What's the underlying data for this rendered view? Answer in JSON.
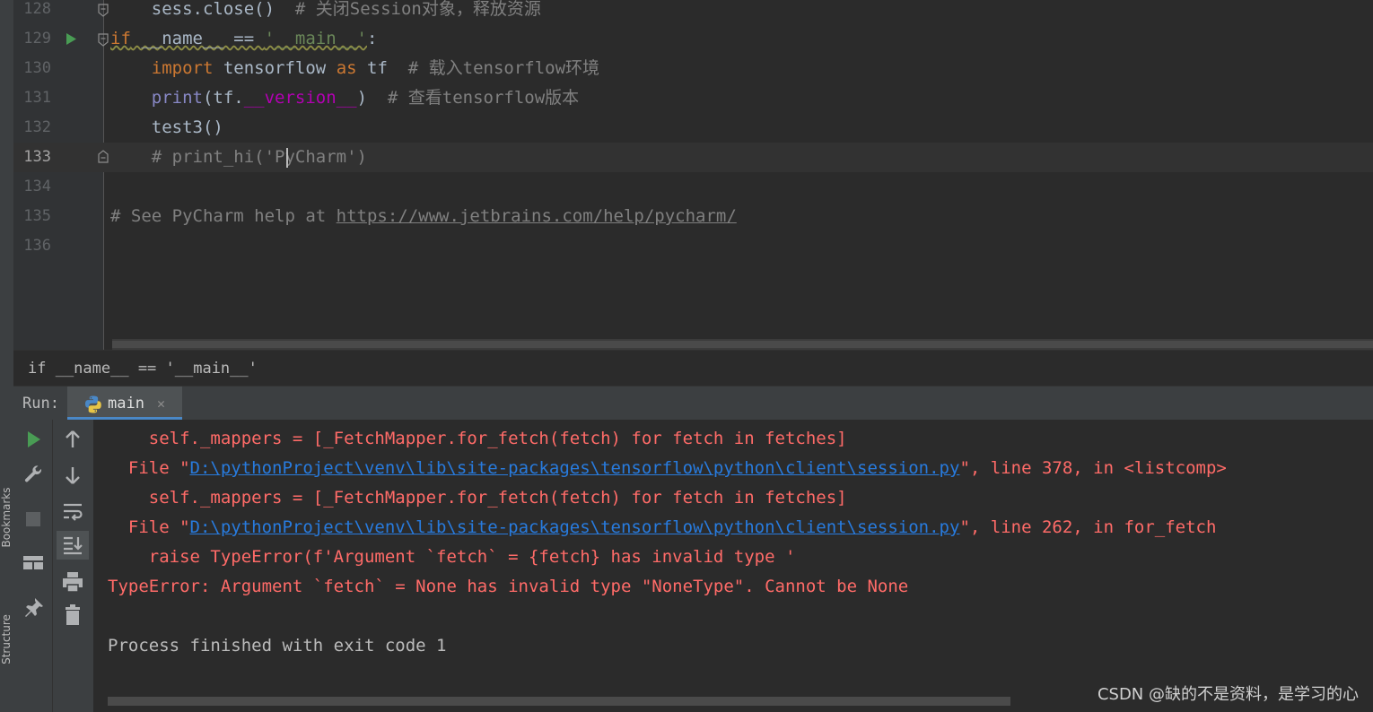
{
  "side_tabs": {
    "bookmarks": "Bookmarks",
    "structure": "Structure"
  },
  "editor": {
    "lines": [
      {
        "num": "128",
        "segments": [
          {
            "t": "    sess.close()  ",
            "c": ""
          },
          {
            "t": "# 关闭Session对象，释放资源",
            "c": "cm"
          }
        ]
      },
      {
        "num": "129",
        "segments": [
          {
            "t": "if",
            "c": "kw wavy"
          },
          {
            "t": " __name__ == ",
            "c": "wavy"
          },
          {
            "t": "'__main__'",
            "c": "str wavy"
          },
          {
            "t": ":",
            "c": ""
          }
        ]
      },
      {
        "num": "130",
        "segments": [
          {
            "t": "    ",
            "c": ""
          },
          {
            "t": "import",
            "c": "kw"
          },
          {
            "t": " tensorflow ",
            "c": ""
          },
          {
            "t": "as",
            "c": "kw"
          },
          {
            "t": " tf  ",
            "c": ""
          },
          {
            "t": "# 载入tensorflow环境",
            "c": "cm"
          }
        ]
      },
      {
        "num": "131",
        "segments": [
          {
            "t": "    ",
            "c": ""
          },
          {
            "t": "print",
            "c": "blt"
          },
          {
            "t": "(tf.",
            "c": ""
          },
          {
            "t": "__version__",
            "c": "dunder"
          },
          {
            "t": ")  ",
            "c": ""
          },
          {
            "t": "# 查看tensorflow版本",
            "c": "cm"
          }
        ]
      },
      {
        "num": "132",
        "segments": [
          {
            "t": "    test3()",
            "c": ""
          }
        ]
      },
      {
        "num": "133",
        "segments": [
          {
            "t": "    # print_hi('PyCharm')",
            "c": "cm"
          }
        ]
      },
      {
        "num": "134",
        "segments": []
      },
      {
        "num": "135",
        "segments": [
          {
            "t": "# See PyCharm help at ",
            "c": "cm"
          },
          {
            "t": "https://www.jetbrains.com/help/pycharm/",
            "c": "link"
          }
        ]
      },
      {
        "num": "136",
        "segments": []
      }
    ],
    "current_line": "133"
  },
  "breadcrumb": "if __name__ == '__main__'",
  "run": {
    "label": "Run:",
    "tab_label": "main",
    "tab_close": "✕"
  },
  "console": {
    "lines": [
      {
        "indent": "    ",
        "prefix": "self._mappers = [_FetchMapper.for_fetch(fetch) for fetch in fetches]",
        "link": "",
        "suffix": "",
        "kind": "error"
      },
      {
        "indent": "  ",
        "prefix": "File \"",
        "link": "D:\\pythonProject\\venv\\lib\\site-packages\\tensorflow\\python\\client\\session.py",
        "suffix": "\", line 378, in <listcomp>",
        "kind": "error"
      },
      {
        "indent": "    ",
        "prefix": "self._mappers = [_FetchMapper.for_fetch(fetch) for fetch in fetches]",
        "link": "",
        "suffix": "",
        "kind": "error"
      },
      {
        "indent": "  ",
        "prefix": "File \"",
        "link": "D:\\pythonProject\\venv\\lib\\site-packages\\tensorflow\\python\\client\\session.py",
        "suffix": "\", line 262, in for_fetch",
        "kind": "error"
      },
      {
        "indent": "    ",
        "prefix": "raise TypeError(f'Argument `fetch` = {fetch} has invalid type '",
        "link": "",
        "suffix": "",
        "kind": "error"
      },
      {
        "indent": "",
        "prefix": "TypeError: Argument `fetch` = None has invalid type \"NoneType\". Cannot be None",
        "link": "",
        "suffix": "",
        "kind": "error"
      },
      {
        "indent": "",
        "prefix": "",
        "link": "",
        "suffix": "",
        "kind": "normal"
      },
      {
        "indent": "",
        "prefix": "Process finished with exit code 1",
        "link": "",
        "suffix": "",
        "kind": "normal"
      }
    ]
  },
  "watermark": "CSDN @缺的不是资料，是学习的心",
  "colors": {
    "error": "#ff6b68",
    "link": "#287bde",
    "run_green": "#499c54",
    "tab_underline": "#4a88c7"
  },
  "icons": {
    "toolbar_left": [
      "run-icon",
      "wrench-icon",
      "stop-icon",
      "layout-icon",
      "pin-icon"
    ],
    "toolbar_right": [
      "arrow-up-icon",
      "arrow-down-icon",
      "soft-wrap-icon",
      "scroll-to-end-icon",
      "print-icon",
      "trash-icon"
    ]
  }
}
